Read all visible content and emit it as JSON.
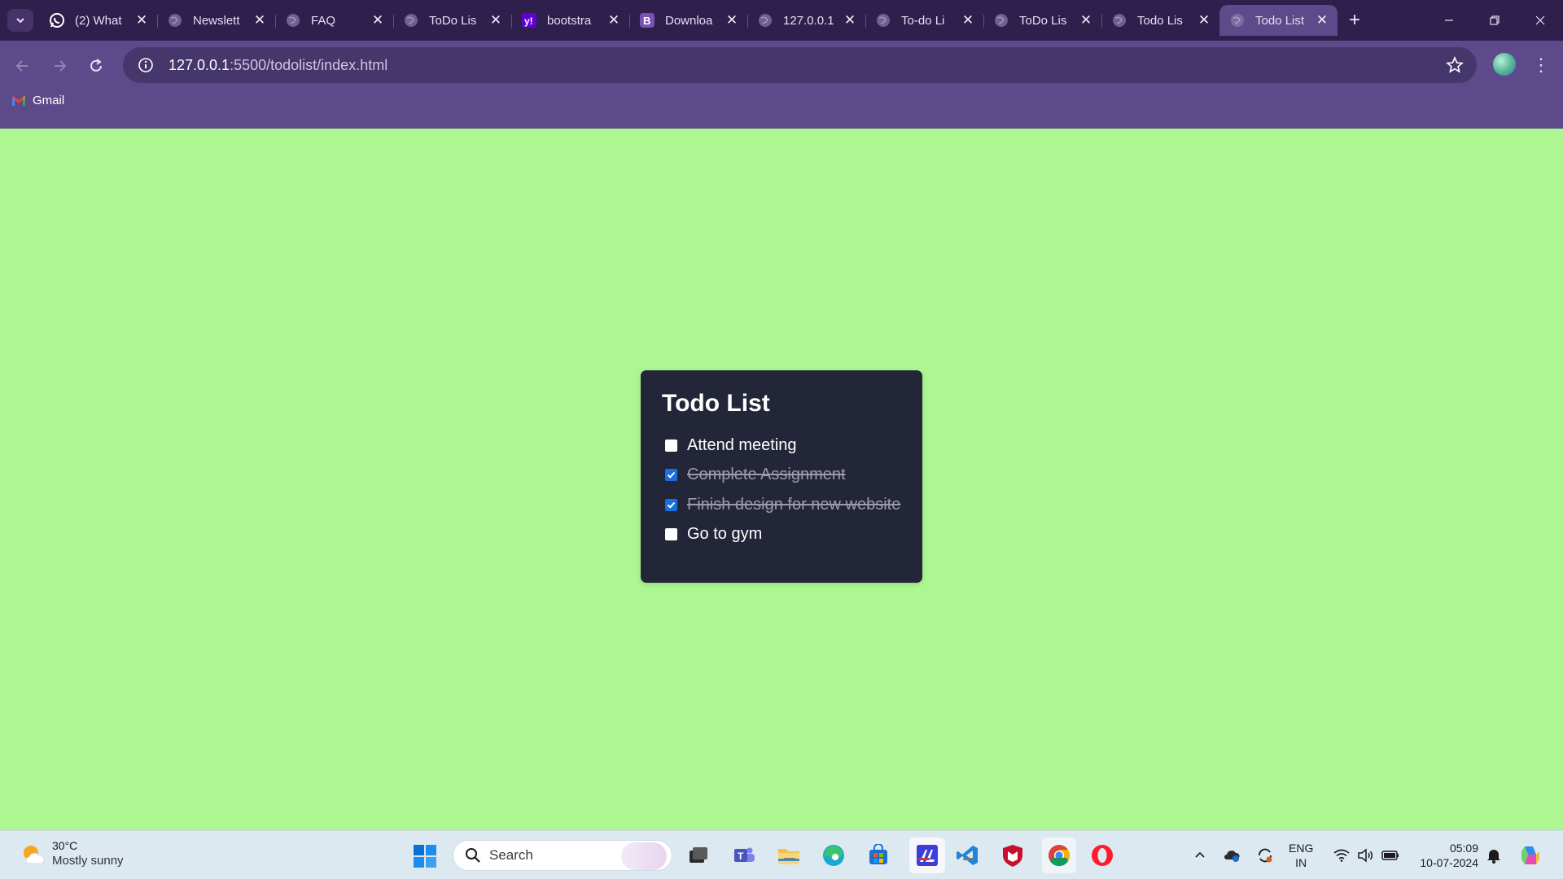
{
  "browser": {
    "tabs": [
      {
        "label": "(2) What",
        "icon": "whatsapp-icon",
        "active": false
      },
      {
        "label": "Newslett",
        "icon": "globe-icon",
        "active": false
      },
      {
        "label": "FAQ",
        "icon": "globe-icon",
        "active": false
      },
      {
        "label": "ToDo Lis",
        "icon": "globe-icon",
        "active": false
      },
      {
        "label": "bootstra",
        "icon": "yahoo-icon",
        "active": false
      },
      {
        "label": "Downloa",
        "icon": "bootstrap-icon",
        "active": false
      },
      {
        "label": "127.0.0.1",
        "icon": "globe-icon",
        "active": false
      },
      {
        "label": "To-do Li",
        "icon": "globe-icon",
        "active": false
      },
      {
        "label": "ToDo Lis",
        "icon": "globe-icon",
        "active": false
      },
      {
        "label": "Todo Lis",
        "icon": "globe-icon",
        "active": false
      },
      {
        "label": "Todo List",
        "icon": "globe-icon",
        "active": true
      }
    ],
    "url_host": "127.0.0.1",
    "url_path": ":5500/todolist/index.html",
    "bookmarks": [
      {
        "label": "Gmail",
        "icon": "gmail-icon"
      }
    ],
    "colors": {
      "tabstrip": "#2e1f4d",
      "toolbar": "#5c4a8a",
      "page_bg": "#adf793"
    }
  },
  "app": {
    "title": "Todo List",
    "todos": [
      {
        "text": "Attend meeting",
        "done": false
      },
      {
        "text": "Complete Assignment",
        "done": true
      },
      {
        "text": "Finish design for new website",
        "done": true
      },
      {
        "text": "Go to gym",
        "done": false
      }
    ],
    "colors": {
      "card": "#232638",
      "checkbox_checked": "#1a6fe0"
    }
  },
  "taskbar": {
    "weather_temp": "30°C",
    "weather_desc": "Mostly sunny",
    "search_placeholder": "Search",
    "lang_line1": "ENG",
    "lang_line2": "IN",
    "time": "05:09",
    "date": "10-07-2024",
    "pinned": [
      "task-view-icon",
      "teams-icon",
      "file-explorer-icon",
      "edge-icon",
      "store-icon",
      "app-icon",
      "vscode-icon",
      "mcafee-icon",
      "chrome-icon",
      "opera-icon"
    ]
  }
}
